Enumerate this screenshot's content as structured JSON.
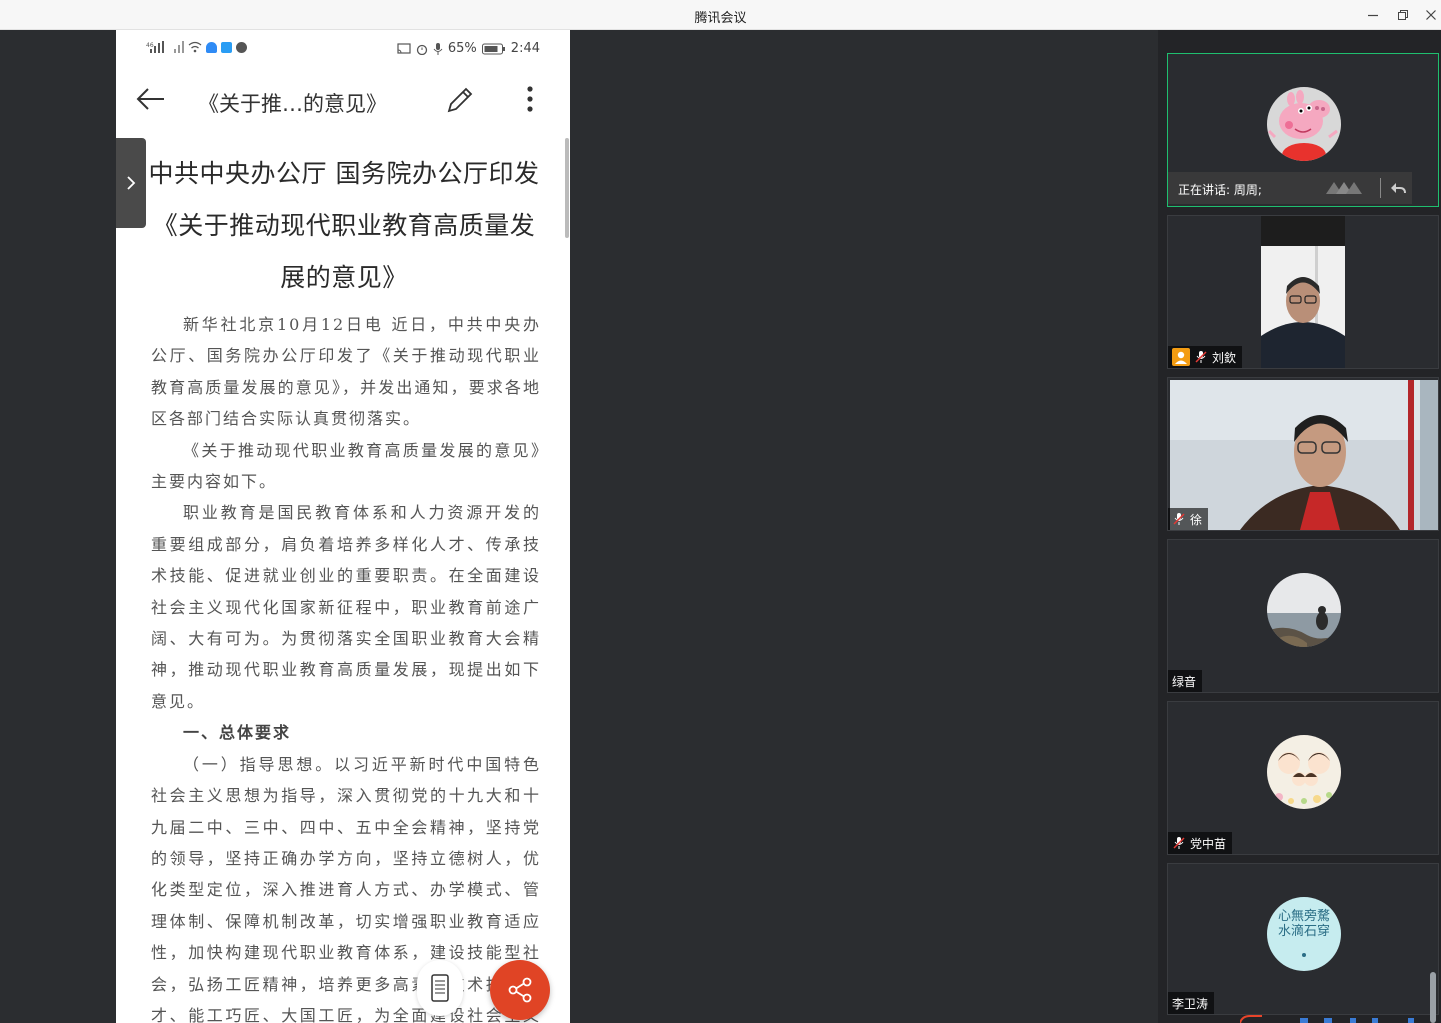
{
  "window": {
    "title": "腾讯会议",
    "minimize_label": "—",
    "restore_label": "⧉",
    "close_label": "✕"
  },
  "phone": {
    "status_left": "⁴⁶ .ıll",
    "battery": "65%",
    "time": "2:44",
    "app_title": "《关于推…的意见》",
    "doc_heading": [
      "中共中央办公厅  国务院办公厅印发",
      "《关于推动现代职业教育高质量发",
      "展的意见》"
    ],
    "paragraphs": [
      "新华社北京10月12日电  近日，中共中央办公厅、国务院办公厅印发了《关于推动现代职业教育高质量发展的意见》，并发出通知，要求各地区各部门结合实际认真贯彻落实。",
      "《关于推动现代职业教育高质量发展的意见》主要内容如下。",
      "职业教育是国民教育体系和人力资源开发的重要组成部分，肩负着培养多样化人才、传承技术技能、促进就业创业的重要职责。在全面建设社会主义现代化国家新征程中，职业教育前途广阔、大有可为。为贯彻落实全国职业教育大会精神，推动现代职业教育高质量发展，现提出如下意见。"
    ],
    "section_title": "一、总体要求",
    "paragraph_after": "（一）指导思想。以习近平新时代中国特色社会主义思想为指导，深入贯彻党的十九大和十九届二中、三中、四中、五中全会精神，坚持党的领导，坚持正确办学方向，坚持立德树人，优化类型定位，深入推进育人方式、办学模式、管理体制、保障机制改革，切实增强职业教育适应性，加快构建现代职业教育体系，建设技能型社会，弘扬工匠精神，培养更多高素质技术技能人才、能工巧匠、大国工匠，为全面建设社会主义现代化国家提供有力人才和技能支撑。"
  },
  "participants": [
    {
      "name": "周周;",
      "speaking_label": "正在讲话: 周周;",
      "type": "avatar",
      "avatar": "peppa-pig",
      "active": true
    },
    {
      "name": "刘欽",
      "type": "video",
      "muted": true,
      "host": true
    },
    {
      "name": "徐",
      "type": "video",
      "muted": true
    },
    {
      "name": "绿音",
      "type": "avatar",
      "avatar": "sea-girl"
    },
    {
      "name": "党中苗",
      "type": "avatar",
      "avatar": "family-cartoon",
      "muted": true
    },
    {
      "name": "李卫涛",
      "type": "avatar",
      "avatar": "calligraphy",
      "avatar_text_top": "心無旁騖",
      "avatar_text_bottom": "水滴石穿"
    }
  ],
  "colors": {
    "accent_green": "#1fbf6f",
    "share_red": "#e04425",
    "panel_bg": "#232427"
  }
}
